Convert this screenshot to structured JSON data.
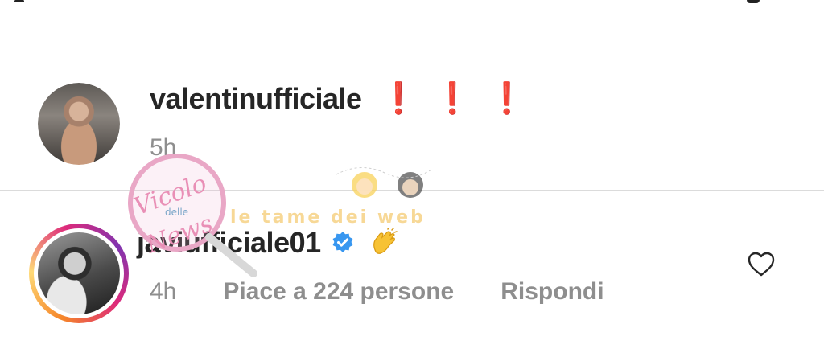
{
  "comments": [
    {
      "username": "valentinufficiale",
      "text": "❗❗❗",
      "time": "5h"
    },
    {
      "username": "javiufficiale01",
      "verified": true,
      "emoji": "clapping-hands",
      "time": "4h",
      "likes_label": "Piace a 224 persone",
      "reply_label": "Rispondi"
    }
  ],
  "watermark": {
    "logo_text": "Vicolo delle News",
    "brand_text": "le tame dei web"
  },
  "colors": {
    "text": "#262626",
    "meta": "#8e8e8e",
    "alert": "#e0182d",
    "verified": "#3897f0"
  },
  "icons": [
    "verified-badge-icon",
    "clapping-hands-emoji",
    "heart-icon"
  ]
}
